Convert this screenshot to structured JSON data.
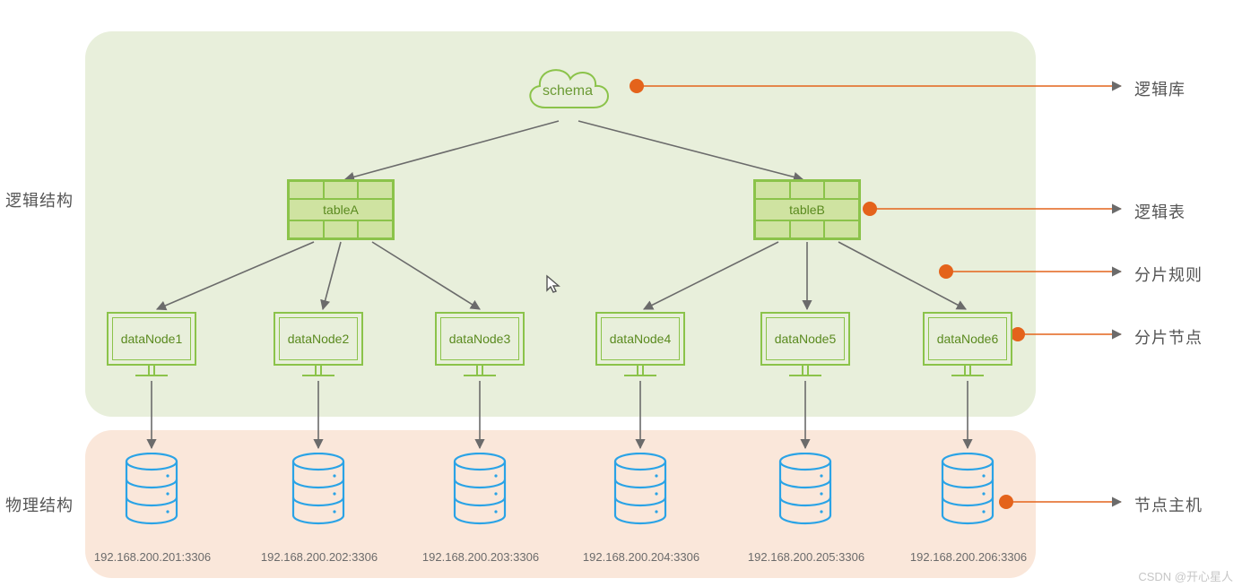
{
  "sections": {
    "logical": "逻辑结构",
    "physical": "物理结构"
  },
  "schema": {
    "label": "schema"
  },
  "tables": {
    "a": "tableA",
    "b": "tableB"
  },
  "nodes": {
    "n1": "dataNode1",
    "n2": "dataNode2",
    "n3": "dataNode3",
    "n4": "dataNode4",
    "n5": "dataNode5",
    "n6": "dataNode6"
  },
  "hosts": {
    "h1": "192.168.200.201:3306",
    "h2": "192.168.200.202:3306",
    "h3": "192.168.200.203:3306",
    "h4": "192.168.200.204:3306",
    "h5": "192.168.200.205:3306",
    "h6": "192.168.200.206:3306"
  },
  "legend": {
    "schema": "逻辑库",
    "table": "逻辑表",
    "rule": "分片规则",
    "node": "分片节点",
    "host": "节点主机"
  },
  "watermark": "CSDN @开心星人"
}
